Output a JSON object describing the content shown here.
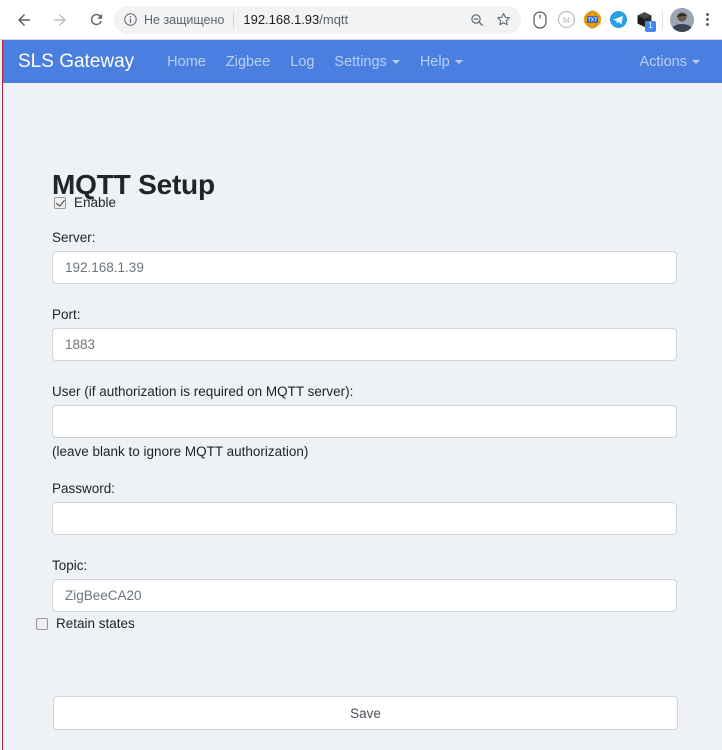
{
  "browser": {
    "back_icon": "back-arrow-icon",
    "forward_icon": "forward-arrow-icon",
    "reload_icon": "reload-icon",
    "security_icon": "info-circle-icon",
    "security_text": "Не защищено",
    "url_host": "192.168.1.93",
    "url_path": "/mqtt",
    "zoom_icon": "search-zoom-icon",
    "bookmark_icon": "star-icon",
    "extensions": [
      {
        "name": "mouse-extension-icon",
        "badge": ""
      },
      {
        "name": "circled-m-extension-icon",
        "badge": ""
      },
      {
        "name": "txt-globe-extension-icon",
        "badge": ""
      },
      {
        "name": "telegram-extension-icon",
        "badge": ""
      },
      {
        "name": "box-extension-icon",
        "badge": "1"
      }
    ],
    "avatar": "profile-avatar",
    "menu_icon": "three-dot-menu-icon"
  },
  "navbar": {
    "brand": "SLS Gateway",
    "links": [
      {
        "label": "Home",
        "caret": false
      },
      {
        "label": "Zigbee",
        "caret": false
      },
      {
        "label": "Log",
        "caret": false
      },
      {
        "label": "Settings",
        "caret": true
      },
      {
        "label": "Help",
        "caret": true
      }
    ],
    "actions": {
      "label": "Actions",
      "caret": true
    },
    "background_color": "#4a7fe0"
  },
  "page": {
    "title": "MQTT Setup",
    "background_color": "#eef2f7"
  },
  "form": {
    "enable": {
      "label": "Enable",
      "checked": true
    },
    "server": {
      "label": "Server:",
      "value": "192.168.1.39"
    },
    "port": {
      "label": "Port:",
      "value": "1883"
    },
    "user": {
      "label": "User (if authorization is required on MQTT server):",
      "value": "",
      "hint": "(leave blank to ignore MQTT authorization)"
    },
    "password": {
      "label": "Password:",
      "value": ""
    },
    "topic": {
      "label": "Topic:",
      "value": "ZigBeeCA20"
    },
    "retain": {
      "label": "Retain states",
      "checked": false
    },
    "save_label": "Save"
  }
}
